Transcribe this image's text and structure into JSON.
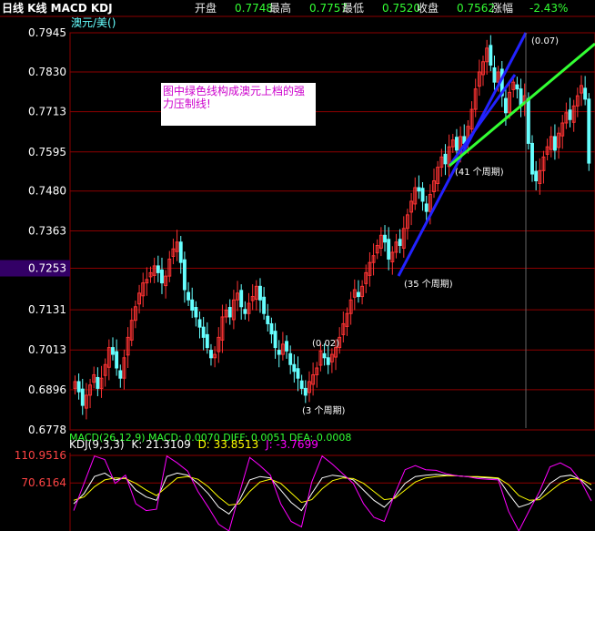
{
  "header": {
    "title": "日线 K线 MACD KDJ",
    "open_label": "开盘",
    "open_value": "0.7748",
    "high_label": "最高",
    "high_value": "0.7757",
    "low_label": "最低",
    "low_value": "0.7520",
    "close_label": "收盘",
    "close_value": "0.7562",
    "change_label": "涨幅",
    "change_value": "-2.43%"
  },
  "symbol": "澳元/美()",
  "note_text": "图中绿色线构成澳元上档的强力压制线!",
  "annotations": {
    "a007": "(0.07)",
    "a41": "(41 个周期)",
    "a35": "(35 个周期)",
    "a002": "(0.02)",
    "a3": "(3 个周期)"
  },
  "macd_label": "MACD(26,12,9) MACD: 0.0070 DIFF: 0.0051 DEA: 0.0008",
  "kdj_label": {
    "name": "KDJ(9,3,3)",
    "k": "K: 21.3109",
    "d": "D: 33.8513",
    "j": "J: -3.7699"
  },
  "colors": {
    "up": "#ff3333",
    "down": "#66ffff",
    "grid": "#8b0000",
    "kdj_j": "#ff00ff",
    "kdj_k": "#ffffff",
    "kdj_d": "#ffff00",
    "green_line": "#33ff33",
    "blue_line": "#2222ff",
    "current_price": "#330066"
  },
  "chart_data": [
    {
      "type": "candlestick",
      "title": "日线 K线",
      "y_ticks": [
        "0.7945",
        "0.7830",
        "0.7713",
        "0.7595",
        "0.7480",
        "0.7363",
        "0.7253",
        "0.7131",
        "0.7013",
        "0.6896",
        "0.6778"
      ],
      "ylim": [
        0.6778,
        0.7945
      ],
      "current_price": 0.7253,
      "last_bar": {
        "open": 0.7748,
        "high": 0.7757,
        "low": 0.752,
        "close": 0.7562
      },
      "closes": [
        0.692,
        0.689,
        0.685,
        0.688,
        0.691,
        0.694,
        0.69,
        0.693,
        0.697,
        0.702,
        0.7,
        0.696,
        0.693,
        0.699,
        0.705,
        0.71,
        0.714,
        0.718,
        0.721,
        0.722,
        0.724,
        0.726,
        0.724,
        0.721,
        0.723,
        0.728,
        0.731,
        0.733,
        0.727,
        0.719,
        0.716,
        0.713,
        0.711,
        0.708,
        0.705,
        0.702,
        0.699,
        0.7,
        0.705,
        0.711,
        0.713,
        0.711,
        0.716,
        0.718,
        0.714,
        0.712,
        0.715,
        0.717,
        0.72,
        0.716,
        0.712,
        0.709,
        0.706,
        0.702,
        0.7,
        0.703,
        0.701,
        0.697,
        0.695,
        0.693,
        0.69,
        0.688,
        0.692,
        0.694,
        0.696,
        0.701,
        0.699,
        0.697,
        0.7,
        0.702,
        0.705,
        0.709,
        0.712,
        0.716,
        0.719,
        0.717,
        0.72,
        0.724,
        0.727,
        0.729,
        0.732,
        0.735,
        0.733,
        0.728,
        0.73,
        0.733,
        0.732,
        0.737,
        0.741,
        0.745,
        0.749,
        0.748,
        0.745,
        0.742,
        0.747,
        0.751,
        0.755,
        0.758,
        0.756,
        0.761,
        0.763,
        0.76,
        0.764,
        0.762,
        0.767,
        0.772,
        0.778,
        0.783,
        0.786,
        0.79,
        0.785,
        0.78,
        0.783,
        0.776,
        0.771,
        0.777,
        0.78,
        0.778,
        0.773,
        0.776,
        0.762,
        0.753,
        0.751,
        0.754,
        0.758,
        0.761,
        0.764,
        0.76,
        0.765,
        0.768,
        0.771,
        0.769,
        0.773,
        0.776,
        0.779,
        0.775,
        0.7562
      ]
    },
    {
      "type": "line",
      "title": "KDJ(9,3,3)",
      "y_ticks": [
        "110.9516",
        "70.6164"
      ],
      "series": [
        {
          "name": "K",
          "values": [
            40,
            55,
            80,
            85,
            75,
            78,
            60,
            50,
            45,
            80,
            85,
            82,
            70,
            55,
            35,
            25,
            45,
            75,
            80,
            78,
            60,
            42,
            30,
            55,
            78,
            82,
            80,
            75,
            60,
            45,
            35,
            50,
            70,
            80,
            82,
            83,
            82,
            81,
            80,
            79,
            78,
            77,
            55,
            35,
            40,
            50,
            70,
            80,
            82,
            75,
            60
          ]
        },
        {
          "name": "D",
          "values": [
            45,
            50,
            65,
            75,
            78,
            77,
            70,
            60,
            52,
            65,
            78,
            80,
            76,
            65,
            50,
            38,
            40,
            58,
            72,
            76,
            70,
            56,
            42,
            46,
            62,
            74,
            78,
            77,
            70,
            58,
            46,
            48,
            60,
            72,
            78,
            80,
            81,
            81,
            80,
            80,
            79,
            78,
            68,
            52,
            45,
            46,
            58,
            70,
            77,
            76,
            68
          ]
        },
        {
          "name": "J",
          "values": [
            30,
            70,
            110,
            105,
            70,
            82,
            40,
            30,
            32,
            110,
            100,
            88,
            58,
            35,
            10,
            0,
            55,
            108,
            96,
            82,
            40,
            14,
            6,
            72,
            110,
            98,
            84,
            70,
            40,
            20,
            14,
            54,
            90,
            96,
            90,
            89,
            84,
            81,
            80,
            77,
            76,
            75,
            29,
            0,
            30,
            58,
            94,
            100,
            92,
            73,
            44
          ]
        }
      ]
    }
  ]
}
